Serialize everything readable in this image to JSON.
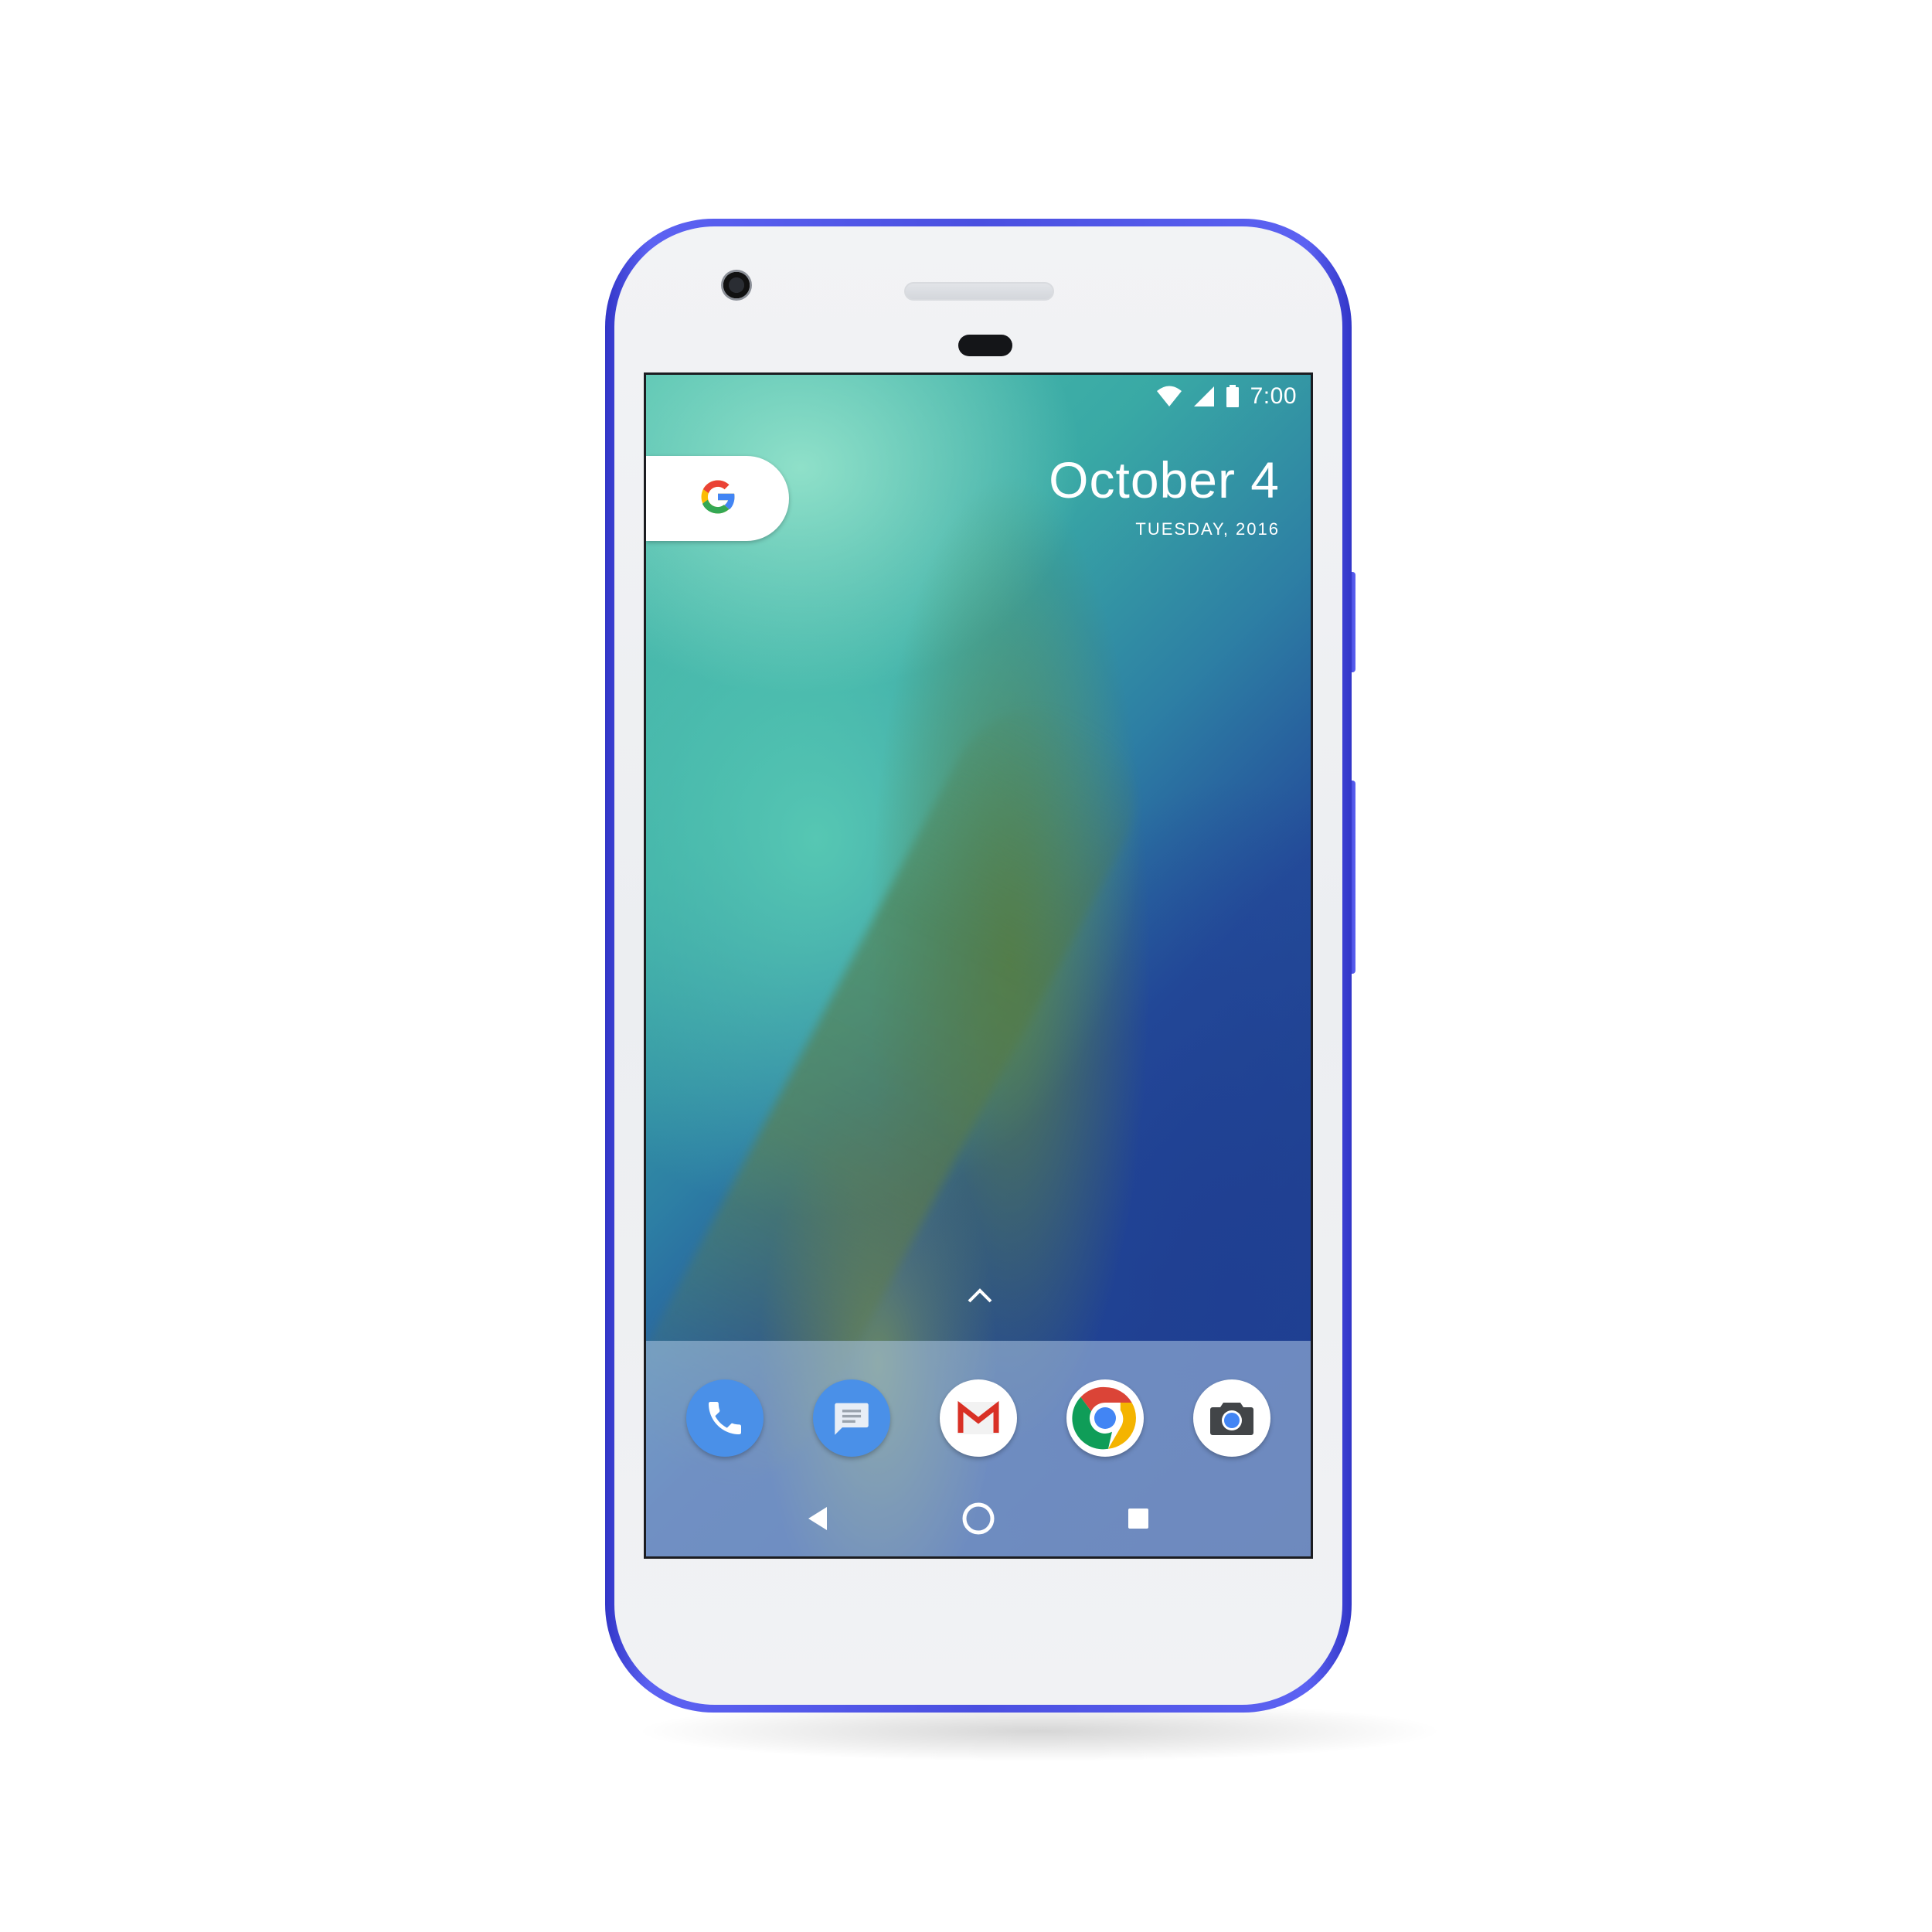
{
  "status_bar": {
    "time": "7:00",
    "icons": [
      "wifi-icon",
      "cell-signal-icon",
      "battery-icon"
    ]
  },
  "google_widget": {
    "icon": "google-g-icon",
    "colors": {
      "blue": "#4285F4",
      "red": "#EA4335",
      "yellow": "#FBBC05",
      "green": "#34A853"
    }
  },
  "date_widget": {
    "date": "October 4",
    "weekday_year": "TUESDAY, 2016"
  },
  "app_drawer": {
    "icon": "chevron-up-icon"
  },
  "dock": {
    "apps": [
      {
        "name": "phone-app-icon",
        "color": "#4A90E8"
      },
      {
        "name": "messages-app-icon",
        "color": "#4A90E8"
      },
      {
        "name": "gmail-app-icon",
        "color": "#FFFFFF"
      },
      {
        "name": "chrome-app-icon",
        "color": "#FFFFFF"
      },
      {
        "name": "camera-app-icon",
        "color": "#FFFFFF"
      }
    ]
  },
  "nav_bar": {
    "buttons": [
      "back-icon",
      "home-icon",
      "overview-icon"
    ]
  },
  "device": {
    "frame_color": "#4A4FE0"
  }
}
